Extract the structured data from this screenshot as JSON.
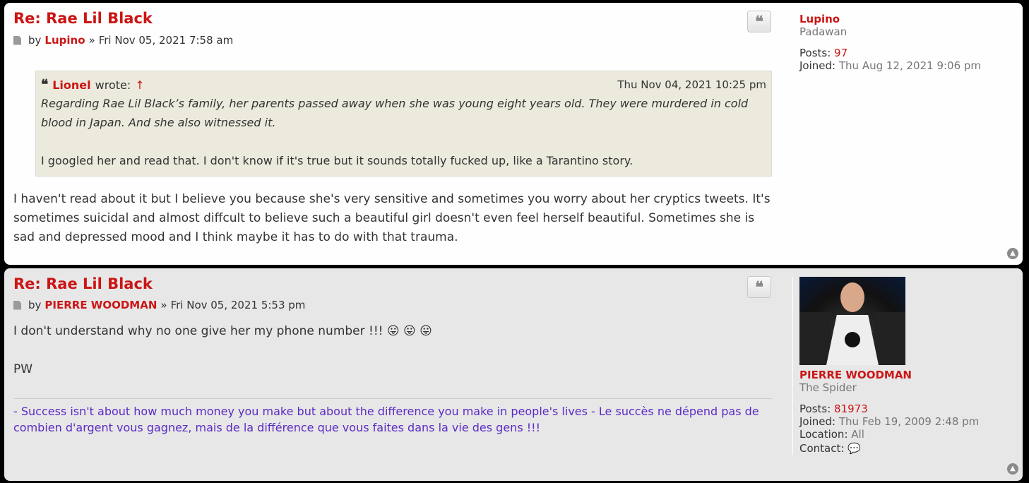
{
  "posts": [
    {
      "title": "Re: Rae Lil Black",
      "by": "by",
      "author": "Lupino",
      "sep": "»",
      "date": "Fri Nov 05, 2021 7:58 am",
      "quote": {
        "author": "Lionel",
        "wrote": "wrote:",
        "arrow": "↑",
        "date": "Thu Nov 04, 2021 10:25 pm",
        "italic": "Regarding Rae Lil Black’s family, her parents passed away when she was young eight years old. They were murdered in cold blood in Japan. And she also witnessed it.",
        "plain": "I googled her and read that. I don't know if it's true but it sounds totally fucked up, like a Tarantino story."
      },
      "body": "I haven't read about it but I believe you because she's very sensitive and sometimes you worry about her cryptics tweets. It's sometimes suicidal and almost diffcult to believe such a beautiful girl doesn't even feel herself beautiful. Sometimes she is sad and depressed mood and I think maybe it has to do with that trauma.",
      "profile": {
        "username": "Lupino",
        "rank": "Padawan",
        "posts_label": "Posts:",
        "posts": "97",
        "joined_label": "Joined:",
        "joined": "Thu Aug 12, 2021 9:06 pm"
      }
    },
    {
      "title": "Re: Rae Lil Black",
      "by": "by",
      "author": "PIERRE WOODMAN",
      "sep": "»",
      "date": "Fri Nov 05, 2021 5:53 pm",
      "body_line1": "I don't understand why no one give her my phone number !!! 😛 😛 😛",
      "body_line2": "PW",
      "signature": "- Success isn't about how much money you make but about the difference you make in people's lives - Le succès ne dépend pas de combien d'argent vous gagnez, mais de la différence que vous faites dans la vie des gens !!!",
      "profile": {
        "username": "PIERRE WOODMAN",
        "rank": "The Spider",
        "posts_label": "Posts:",
        "posts": "81973",
        "joined_label": "Joined:",
        "joined": "Thu Feb 19, 2009 2:48 pm",
        "location_label": "Location:",
        "location": "All",
        "contact_label": "Contact:"
      }
    }
  ],
  "icons": {
    "quote_button": "quote-icon",
    "top_button": "chevron-up-icon",
    "post_icon": "document-icon",
    "contact": "speech-bubble-icon"
  },
  "colors": {
    "link_red": "#cc1515",
    "signature_purple": "#5b2bc4",
    "post1_bg": "#fefefe",
    "post2_bg": "#e7e7e7",
    "quote_bg": "#ebeadd"
  }
}
